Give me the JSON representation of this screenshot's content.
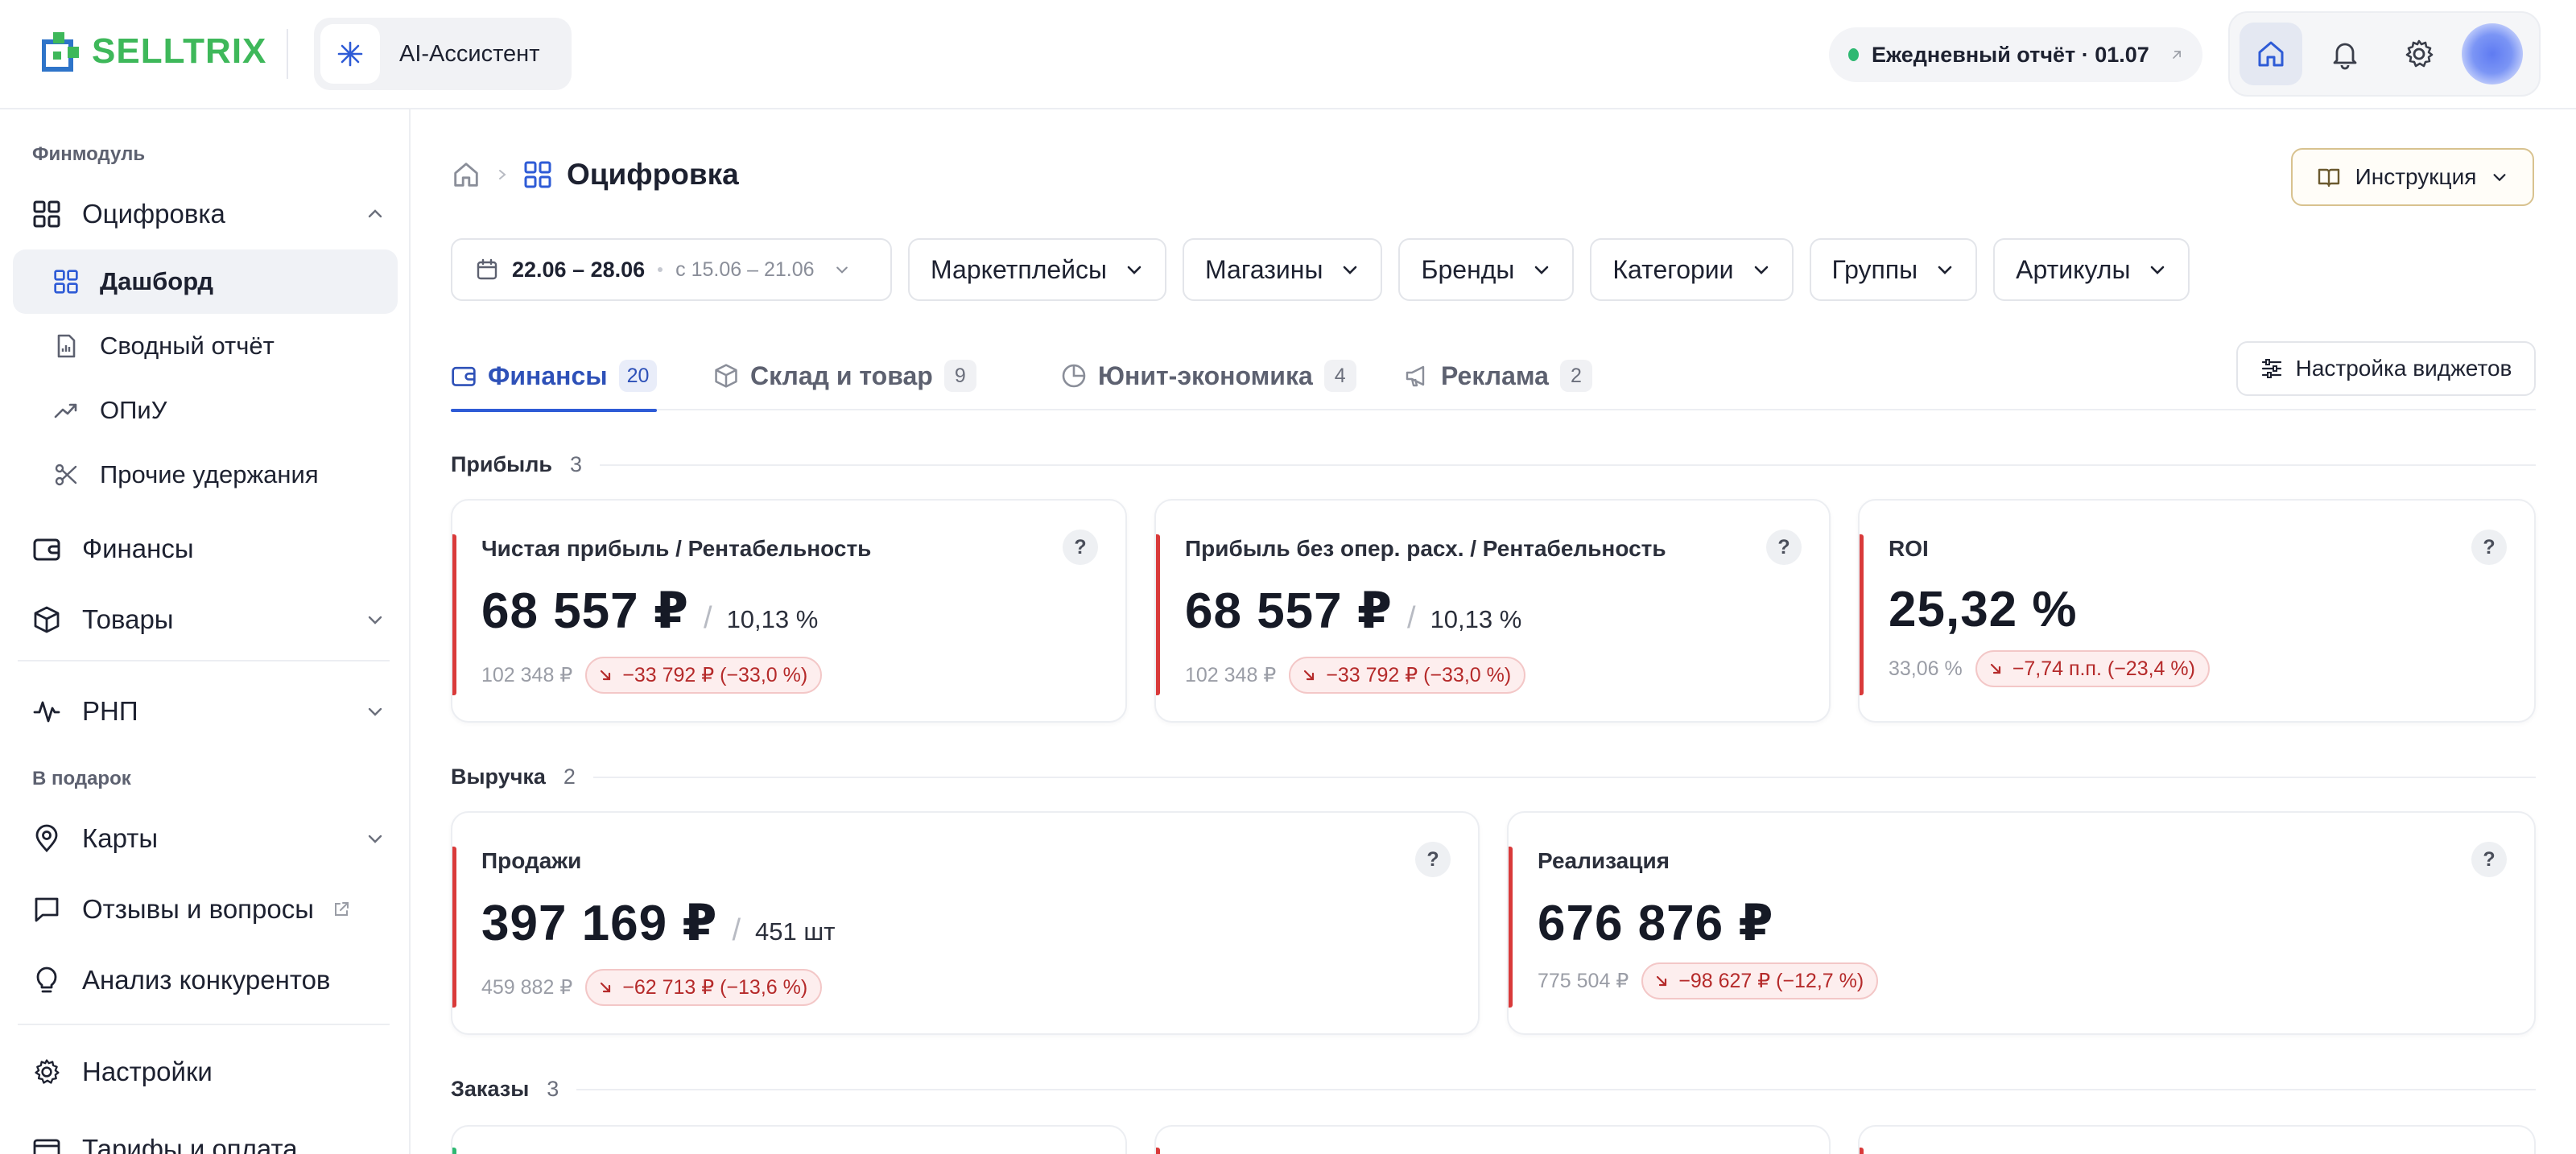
{
  "app": {
    "logo_text": "SELLTRIX",
    "ai_assistant_label": "AI-Ассистент",
    "daily_report_label": "Ежедневный отчёт · 01.07"
  },
  "sidebar": {
    "section_finmodule": "Финмодуль",
    "section_gift": "В подарок",
    "items": [
      {
        "label": "Оцифровка",
        "icon": "grid-icon",
        "expanded": true
      },
      {
        "label": "Дашборд",
        "icon": "grid-icon",
        "active": true
      },
      {
        "label": "Сводный отчёт",
        "icon": "report-icon"
      },
      {
        "label": "ОПиУ",
        "icon": "trend-icon"
      },
      {
        "label": "Прочие удержания",
        "icon": "scissors-icon"
      },
      {
        "label": "Финансы",
        "icon": "wallet-icon"
      },
      {
        "label": "Товары",
        "icon": "box-icon"
      },
      {
        "label": "РНП",
        "icon": "pulse-icon"
      },
      {
        "label": "Карты",
        "icon": "map-pin-icon"
      },
      {
        "label": "Отзывы и вопросы",
        "icon": "chat-icon"
      },
      {
        "label": "Анализ конкурентов",
        "icon": "bulb-icon"
      },
      {
        "label": "Настройки",
        "icon": "gear-icon"
      },
      {
        "label": "Тарифы и оплата",
        "icon": "card-icon"
      }
    ]
  },
  "page": {
    "title": "Оцифровка",
    "instruction_label": "Инструкция"
  },
  "filters": {
    "date_current": "22.06 – 28.06",
    "date_compare": "с 15.06 – 21.06",
    "buttons": [
      "Маркетплейсы",
      "Магазины",
      "Бренды",
      "Категории",
      "Группы",
      "Артикулы"
    ]
  },
  "tabs": [
    {
      "label": "Финансы",
      "count": "20",
      "icon": "wallet-icon",
      "active": true
    },
    {
      "label": "Склад и товар",
      "count": "9",
      "icon": "box-icon"
    },
    {
      "label": "Юнит-экономика",
      "count": "4",
      "icon": "pie-icon"
    },
    {
      "label": "Реклама",
      "count": "2",
      "icon": "megaphone-icon"
    }
  ],
  "widgets_settings_label": "Настройка виджетов",
  "groups": [
    {
      "title": "Прибыль",
      "count": "3",
      "cards": [
        {
          "title": "Чистая прибыль / Рентабельность",
          "value": "68 557 ₽",
          "secondary": "10,13 %",
          "previous": "102 348 ₽",
          "delta": "−33 792 ₽ (−33,0 %)"
        },
        {
          "title": "Прибыль без опер. расх. / Рентабельность",
          "value": "68 557 ₽",
          "secondary": "10,13 %",
          "previous": "102 348 ₽",
          "delta": "−33 792 ₽ (−33,0 %)"
        },
        {
          "title": "ROI",
          "value": "25,32 %",
          "secondary": "",
          "previous": "33,06 %",
          "delta": "−7,74 п.п. (−23,4 %)"
        }
      ]
    },
    {
      "title": "Выручка",
      "count": "2",
      "cards": [
        {
          "title": "Продажи",
          "value": "397 169 ₽",
          "secondary": "451 шт",
          "previous": "459 882 ₽",
          "delta": "−62 713 ₽ (−13,6 %)"
        },
        {
          "title": "Реализация",
          "value": "676 876 ₽",
          "secondary": "",
          "previous": "775 504 ₽",
          "delta": "−98 627 ₽ (−12,7 %)"
        }
      ]
    },
    {
      "title": "Заказы",
      "count": "3"
    }
  ],
  "help_glyph": "?",
  "colors": {
    "brand_green": "#3eb85a",
    "brand_blue": "#2e5bd6",
    "negative": "#d93a3a",
    "positive": "#2eb872"
  }
}
